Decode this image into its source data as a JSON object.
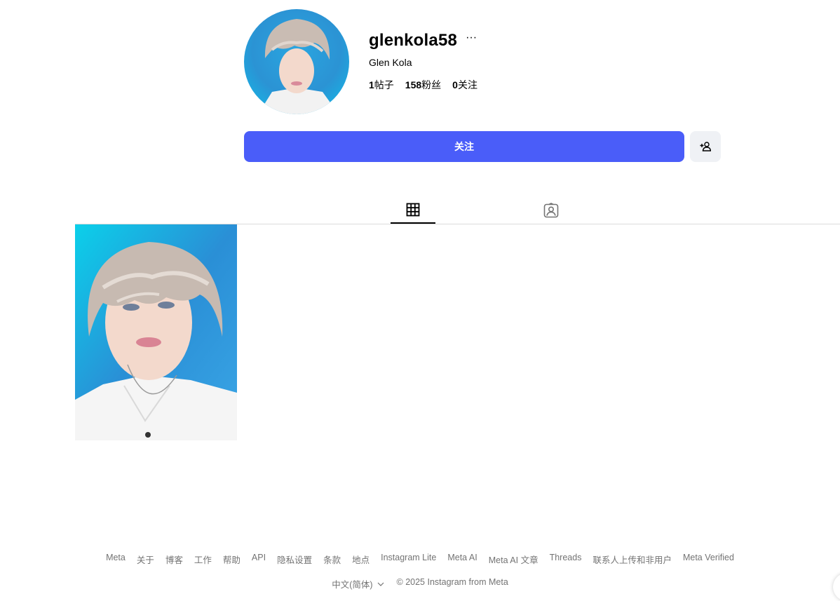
{
  "profile": {
    "username": "glenkola58",
    "more_label": "···",
    "full_name": "Glen Kola",
    "stats": [
      {
        "count": "1",
        "label": "帖子"
      },
      {
        "count": "158",
        "label": "粉丝"
      },
      {
        "count": "0",
        "label": "关注"
      }
    ]
  },
  "actions": {
    "follow_label": "关注",
    "suggest_icon": "person-add-icon"
  },
  "tabs": [
    {
      "icon": "grid-icon",
      "active": true
    },
    {
      "icon": "tagged-icon",
      "active": false
    }
  ],
  "posts_count": 1,
  "footer": {
    "links": [
      "Meta",
      "关于",
      "博客",
      "工作",
      "帮助",
      "API",
      "隐私设置",
      "条款",
      "地点",
      "Instagram Lite",
      "Meta AI",
      "Meta AI 文章",
      "Threads",
      "联系人上传和非用户",
      "Meta Verified"
    ],
    "language": "中文(简体)",
    "copyright": "© 2025 Instagram from Meta"
  },
  "colors": {
    "accent": "#4a5df9",
    "secondary_button": "#eff1f5",
    "muted_text": "#737373"
  }
}
